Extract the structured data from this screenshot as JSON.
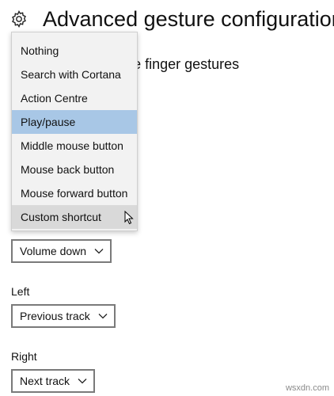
{
  "header": {
    "title": "Advanced gesture configuration",
    "icon": "gear-icon"
  },
  "section": {
    "heading": "Configure your three finger gestures"
  },
  "dropdown": {
    "items": [
      "Nothing",
      "Search with Cortana",
      "Action Centre",
      "Play/pause",
      "Middle mouse button",
      "Mouse back button",
      "Mouse forward button",
      "Custom shortcut"
    ],
    "selected_index": 3,
    "hovered_index": 7
  },
  "fields": {
    "down": {
      "value": "Volume down"
    },
    "left": {
      "label": "Left",
      "value": "Previous track"
    },
    "right": {
      "label": "Right",
      "value": "Next track"
    }
  },
  "colors": {
    "selected": "#a8c7e6",
    "hovered": "#d9d9d9",
    "menu_bg": "#f2f2f2"
  },
  "watermark": "wsxdn.com"
}
